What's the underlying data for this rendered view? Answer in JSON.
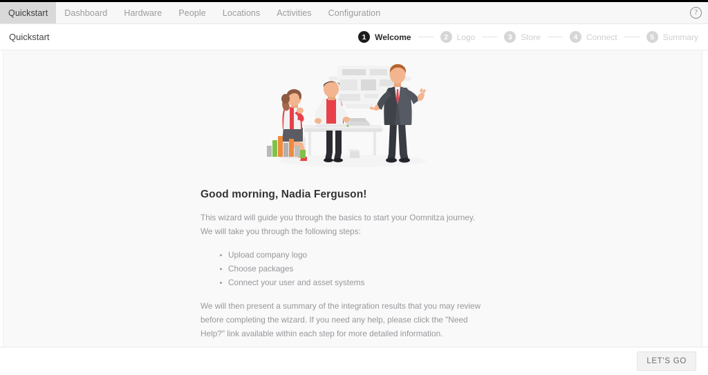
{
  "nav": {
    "items": [
      {
        "label": "Quickstart",
        "active": true
      },
      {
        "label": "Dashboard",
        "active": false
      },
      {
        "label": "Hardware",
        "active": false
      },
      {
        "label": "People",
        "active": false
      },
      {
        "label": "Locations",
        "active": false
      },
      {
        "label": "Activities",
        "active": false
      },
      {
        "label": "Configuration",
        "active": false
      }
    ],
    "help_icon": "question-circle-icon",
    "help_glyph": "?"
  },
  "subheader": {
    "breadcrumb": "Quickstart",
    "steps": [
      {
        "number": "1",
        "label": "Welcome",
        "active": true
      },
      {
        "number": "2",
        "label": "Logo",
        "active": false
      },
      {
        "number": "3",
        "label": "Store",
        "active": false
      },
      {
        "number": "4",
        "label": "Connect",
        "active": false
      },
      {
        "number": "5",
        "label": "Summary",
        "active": false
      }
    ]
  },
  "main": {
    "illustration_name": "team-presentation-illustration",
    "greeting": "Good morning, Nadia Ferguson!",
    "intro_paragraph": "This wizard will guide you through the basics to start your Oomnitza journey. We will take you through the following steps:",
    "bullets": [
      "Upload company logo",
      "Choose packages",
      "Connect your user and asset systems"
    ],
    "closing_paragraph": "We will then present a summary of the integration results that you may review before completing the wizard. If you need any help, please click the \"Need Help?\" link available within each step for more detailed information."
  },
  "footer": {
    "cta_label": "LET'S GO"
  },
  "colors": {
    "top_strip": "#000000",
    "nav_bg": "#f7f7f7",
    "nav_active_bg": "#d9d9d9",
    "content_bg": "#f9f9f9",
    "step_active": "#1d1d1d",
    "step_inactive": "#d6d6d6",
    "body_text": "#97969c",
    "heading_text": "#343434",
    "cta_bg": "#f2f2f2",
    "illus_red": "#e8404a",
    "illus_orange": "#f08a3c",
    "illus_green": "#7fc24a",
    "illus_suit": "#3f4248",
    "illus_skin": "#f3b58f"
  }
}
